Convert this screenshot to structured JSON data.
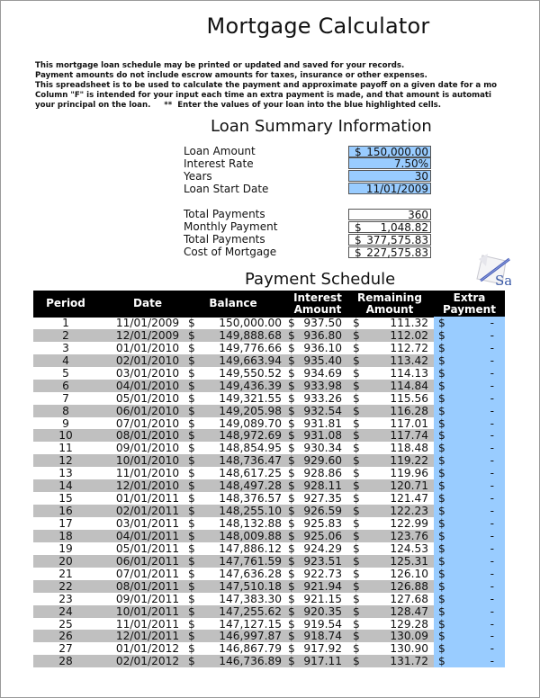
{
  "title": "Mortgage Calculator",
  "intro_lines": [
    "This mortgage loan schedule may be printed or updated and saved for your records.",
    "Payment amounts do not include escrow amounts for taxes, insurance or other expenses.",
    "This spreadsheet is to be used to calculate the payment and approximate payoff on a given date for a mo",
    "Column \"F\" is intended for your input each time an extra payment is made, and that amount is automati",
    "your principal on the loan.     **  Enter the values of your loan into the blue highlighted cells."
  ],
  "summary": {
    "title": "Loan Summary Information",
    "inputs": [
      {
        "label": "Loan Amount",
        "currency": "$",
        "value": "150,000.00"
      },
      {
        "label": "Interest Rate",
        "currency": "",
        "value": "7.50%"
      },
      {
        "label": "Years",
        "currency": "",
        "value": "30"
      },
      {
        "label": "Loan Start Date",
        "currency": "",
        "value": "11/01/2009"
      }
    ],
    "outputs": [
      {
        "label": "Total Payments",
        "currency": "",
        "value": "360"
      },
      {
        "label": "Monthly Payment",
        "currency": "$",
        "value": "1,048.82"
      },
      {
        "label": "Total Payments",
        "currency": "$",
        "value": "377,575.83"
      },
      {
        "label": "Cost of Mortgage",
        "currency": "$",
        "value": "227,575.83"
      }
    ]
  },
  "logo_icon": "sample-pen-logo-icon",
  "logo_text": "Sa",
  "schedule": {
    "title": "Payment Schedule",
    "headers": {
      "period": "Period",
      "date": "Date",
      "balance": "Balance",
      "interest_1": "Interest",
      "interest_2": "Amount",
      "remaining_1": "Remaining",
      "remaining_2": "Amount",
      "extra_1": "Extra",
      "extra_2": "Payment"
    },
    "currency": "$",
    "extra_value": "-",
    "rows": [
      {
        "period": "1",
        "date": "11/01/2009",
        "balance": "150,000.00",
        "interest": "937.50",
        "remaining": "111.32"
      },
      {
        "period": "2",
        "date": "12/01/2009",
        "balance": "149,888.68",
        "interest": "936.80",
        "remaining": "112.02"
      },
      {
        "period": "3",
        "date": "01/01/2010",
        "balance": "149,776.66",
        "interest": "936.10",
        "remaining": "112.72"
      },
      {
        "period": "4",
        "date": "02/01/2010",
        "balance": "149,663.94",
        "interest": "935.40",
        "remaining": "113.42"
      },
      {
        "period": "5",
        "date": "03/01/2010",
        "balance": "149,550.52",
        "interest": "934.69",
        "remaining": "114.13"
      },
      {
        "period": "6",
        "date": "04/01/2010",
        "balance": "149,436.39",
        "interest": "933.98",
        "remaining": "114.84"
      },
      {
        "period": "7",
        "date": "05/01/2010",
        "balance": "149,321.55",
        "interest": "933.26",
        "remaining": "115.56"
      },
      {
        "period": "8",
        "date": "06/01/2010",
        "balance": "149,205.98",
        "interest": "932.54",
        "remaining": "116.28"
      },
      {
        "period": "9",
        "date": "07/01/2010",
        "balance": "149,089.70",
        "interest": "931.81",
        "remaining": "117.01"
      },
      {
        "period": "10",
        "date": "08/01/2010",
        "balance": "148,972.69",
        "interest": "931.08",
        "remaining": "117.74"
      },
      {
        "period": "11",
        "date": "09/01/2010",
        "balance": "148,854.95",
        "interest": "930.34",
        "remaining": "118.48"
      },
      {
        "period": "12",
        "date": "10/01/2010",
        "balance": "148,736.47",
        "interest": "929.60",
        "remaining": "119.22"
      },
      {
        "period": "13",
        "date": "11/01/2010",
        "balance": "148,617.25",
        "interest": "928.86",
        "remaining": "119.96"
      },
      {
        "period": "14",
        "date": "12/01/2010",
        "balance": "148,497.28",
        "interest": "928.11",
        "remaining": "120.71"
      },
      {
        "period": "15",
        "date": "01/01/2011",
        "balance": "148,376.57",
        "interest": "927.35",
        "remaining": "121.47"
      },
      {
        "period": "16",
        "date": "02/01/2011",
        "balance": "148,255.10",
        "interest": "926.59",
        "remaining": "122.23"
      },
      {
        "period": "17",
        "date": "03/01/2011",
        "balance": "148,132.88",
        "interest": "925.83",
        "remaining": "122.99"
      },
      {
        "period": "18",
        "date": "04/01/2011",
        "balance": "148,009.88",
        "interest": "925.06",
        "remaining": "123.76"
      },
      {
        "period": "19",
        "date": "05/01/2011",
        "balance": "147,886.12",
        "interest": "924.29",
        "remaining": "124.53"
      },
      {
        "period": "20",
        "date": "06/01/2011",
        "balance": "147,761.59",
        "interest": "923.51",
        "remaining": "125.31"
      },
      {
        "period": "21",
        "date": "07/01/2011",
        "balance": "147,636.28",
        "interest": "922.73",
        "remaining": "126.10"
      },
      {
        "period": "22",
        "date": "08/01/2011",
        "balance": "147,510.18",
        "interest": "921.94",
        "remaining": "126.88"
      },
      {
        "period": "23",
        "date": "09/01/2011",
        "balance": "147,383.30",
        "interest": "921.15",
        "remaining": "127.68"
      },
      {
        "period": "24",
        "date": "10/01/2011",
        "balance": "147,255.62",
        "interest": "920.35",
        "remaining": "128.47"
      },
      {
        "period": "25",
        "date": "11/01/2011",
        "balance": "147,127.15",
        "interest": "919.54",
        "remaining": "129.28"
      },
      {
        "period": "26",
        "date": "12/01/2011",
        "balance": "146,997.87",
        "interest": "918.74",
        "remaining": "130.09"
      },
      {
        "period": "27",
        "date": "01/01/2012",
        "balance": "146,867.79",
        "interest": "917.92",
        "remaining": "130.90"
      },
      {
        "period": "28",
        "date": "02/01/2012",
        "balance": "146,736.89",
        "interest": "917.11",
        "remaining": "131.72"
      }
    ]
  },
  "colors": {
    "input_blue": "#99ccff",
    "header_black": "#000000",
    "row_alt_gray": "#c0c0c0"
  }
}
